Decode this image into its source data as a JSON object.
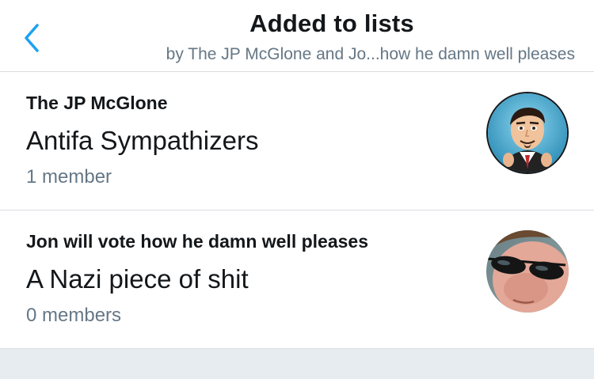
{
  "header": {
    "title": "Added to lists",
    "subtitle": "by The JP McGlone and Jo...how he damn well pleases",
    "back_icon": "chevron-left-icon",
    "accent_color": "#1da1f2"
  },
  "lists": [
    {
      "owner": "The JP McGlone",
      "name": "Antifa Sympathizers",
      "members": "1 member",
      "avatar_icon": "cartoon-avatar"
    },
    {
      "owner": "Jon will vote how he damn well pleases",
      "name": "A Nazi piece of shit",
      "members": "0 members",
      "avatar_icon": "photo-avatar-sunglasses"
    }
  ]
}
